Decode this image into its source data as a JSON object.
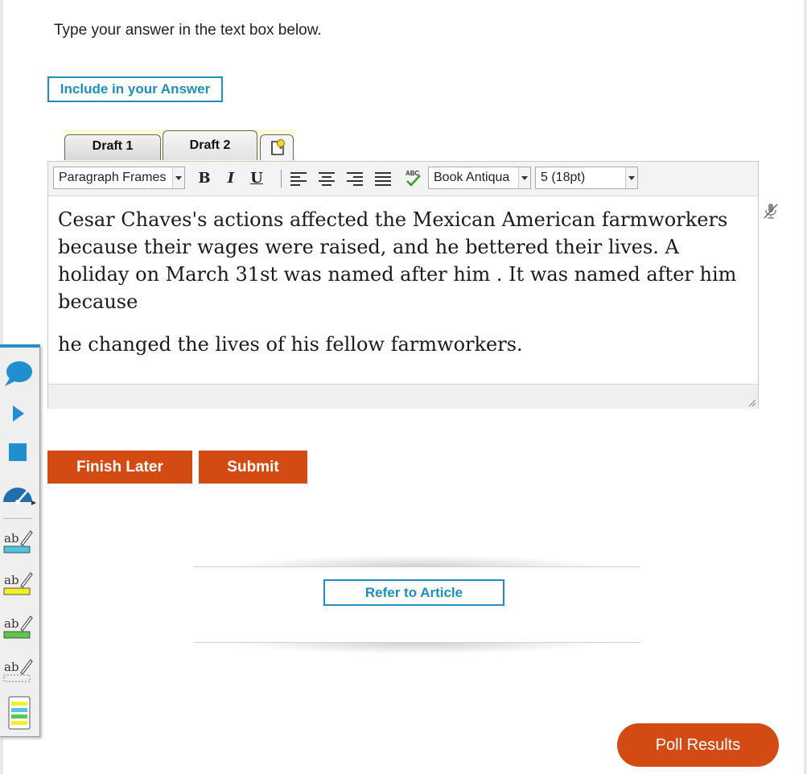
{
  "instruction": "Type your answer in the text box below.",
  "include_button": "Include in your Answer",
  "tabs": [
    {
      "label": "Draft 1"
    },
    {
      "label": "Draft 2"
    }
  ],
  "toolbar": {
    "format_select": "Paragraph Frames",
    "bold": "B",
    "italic": "I",
    "underline": "U",
    "font_select": "Book Antiqua",
    "size_select": "5 (18pt)"
  },
  "answer": {
    "paragraph1": "Cesar Chaves's actions affected the Mexican American farmworkers because their wages were raised, and he bettered their lives. A holiday on March 31st was named after him . It was named after him because",
    "paragraph2": "he changed the lives of his fellow farmworkers."
  },
  "buttons": {
    "finish_later": "Finish Later",
    "submit": "Submit",
    "refer_to_article": "Refer to Article",
    "poll_results": "Poll Results"
  },
  "colors": {
    "accent_blue": "#1c8fc0",
    "action_orange": "#d34a12"
  },
  "palette_icons": [
    "speech-bubble-icon",
    "play-icon",
    "stop-icon",
    "speed-gauge-icon",
    "highlight-blue-icon",
    "highlight-yellow-icon",
    "highlight-green-icon",
    "highlight-clear-icon",
    "notes-icon"
  ]
}
